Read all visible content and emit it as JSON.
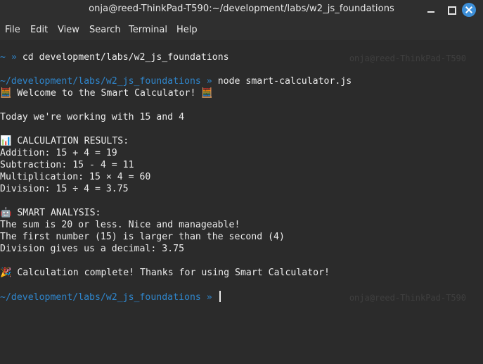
{
  "window": {
    "title": "onja@reed-ThinkPad-T590:~/development/labs/w2_js_foundations"
  },
  "menu": {
    "file": "File",
    "edit": "Edit",
    "view": "View",
    "search": "Search",
    "terminal": "Terminal",
    "help": "Help"
  },
  "terminal": {
    "line1_path": "~",
    "line1_arrow": "»",
    "line1_cmd": "cd development/labs/w2_js_foundations",
    "ghost1": "onja@reed-ThinkPad-T590",
    "line2_path": "~/development/labs/w2_js_foundations",
    "line2_arrow": "»",
    "line2_cmd": "node smart-calculator.js",
    "welcome": "🧮 Welcome to the Smart Calculator! 🧮",
    "today": "Today we're working with 15 and 4",
    "results_header": "📊 CALCULATION RESULTS:",
    "addition": "Addition: 15 + 4 = 19",
    "subtraction": "Subtraction: 15 - 4 = 11",
    "multiplication": "Multiplication: 15 × 4 = 60",
    "division": "Division: 15 ÷ 4 = 3.75",
    "analysis_header": "🤖 SMART ANALYSIS:",
    "analysis1": "The sum is 20 or less. Nice and manageable!",
    "analysis2": "The first number (15) is larger than the second (4)",
    "analysis3": "Division gives us a decimal: 3.75",
    "complete": "🎉 Calculation complete! Thanks for using Smart Calculator!",
    "line3_path": "~/development/labs/w2_js_foundations",
    "line3_arrow": "»",
    "ghost2": "onja@reed-ThinkPad-T590"
  },
  "colors": {
    "prompt_path": "#2f86cc",
    "text": "#ececec",
    "background": "#2b2b2b"
  }
}
